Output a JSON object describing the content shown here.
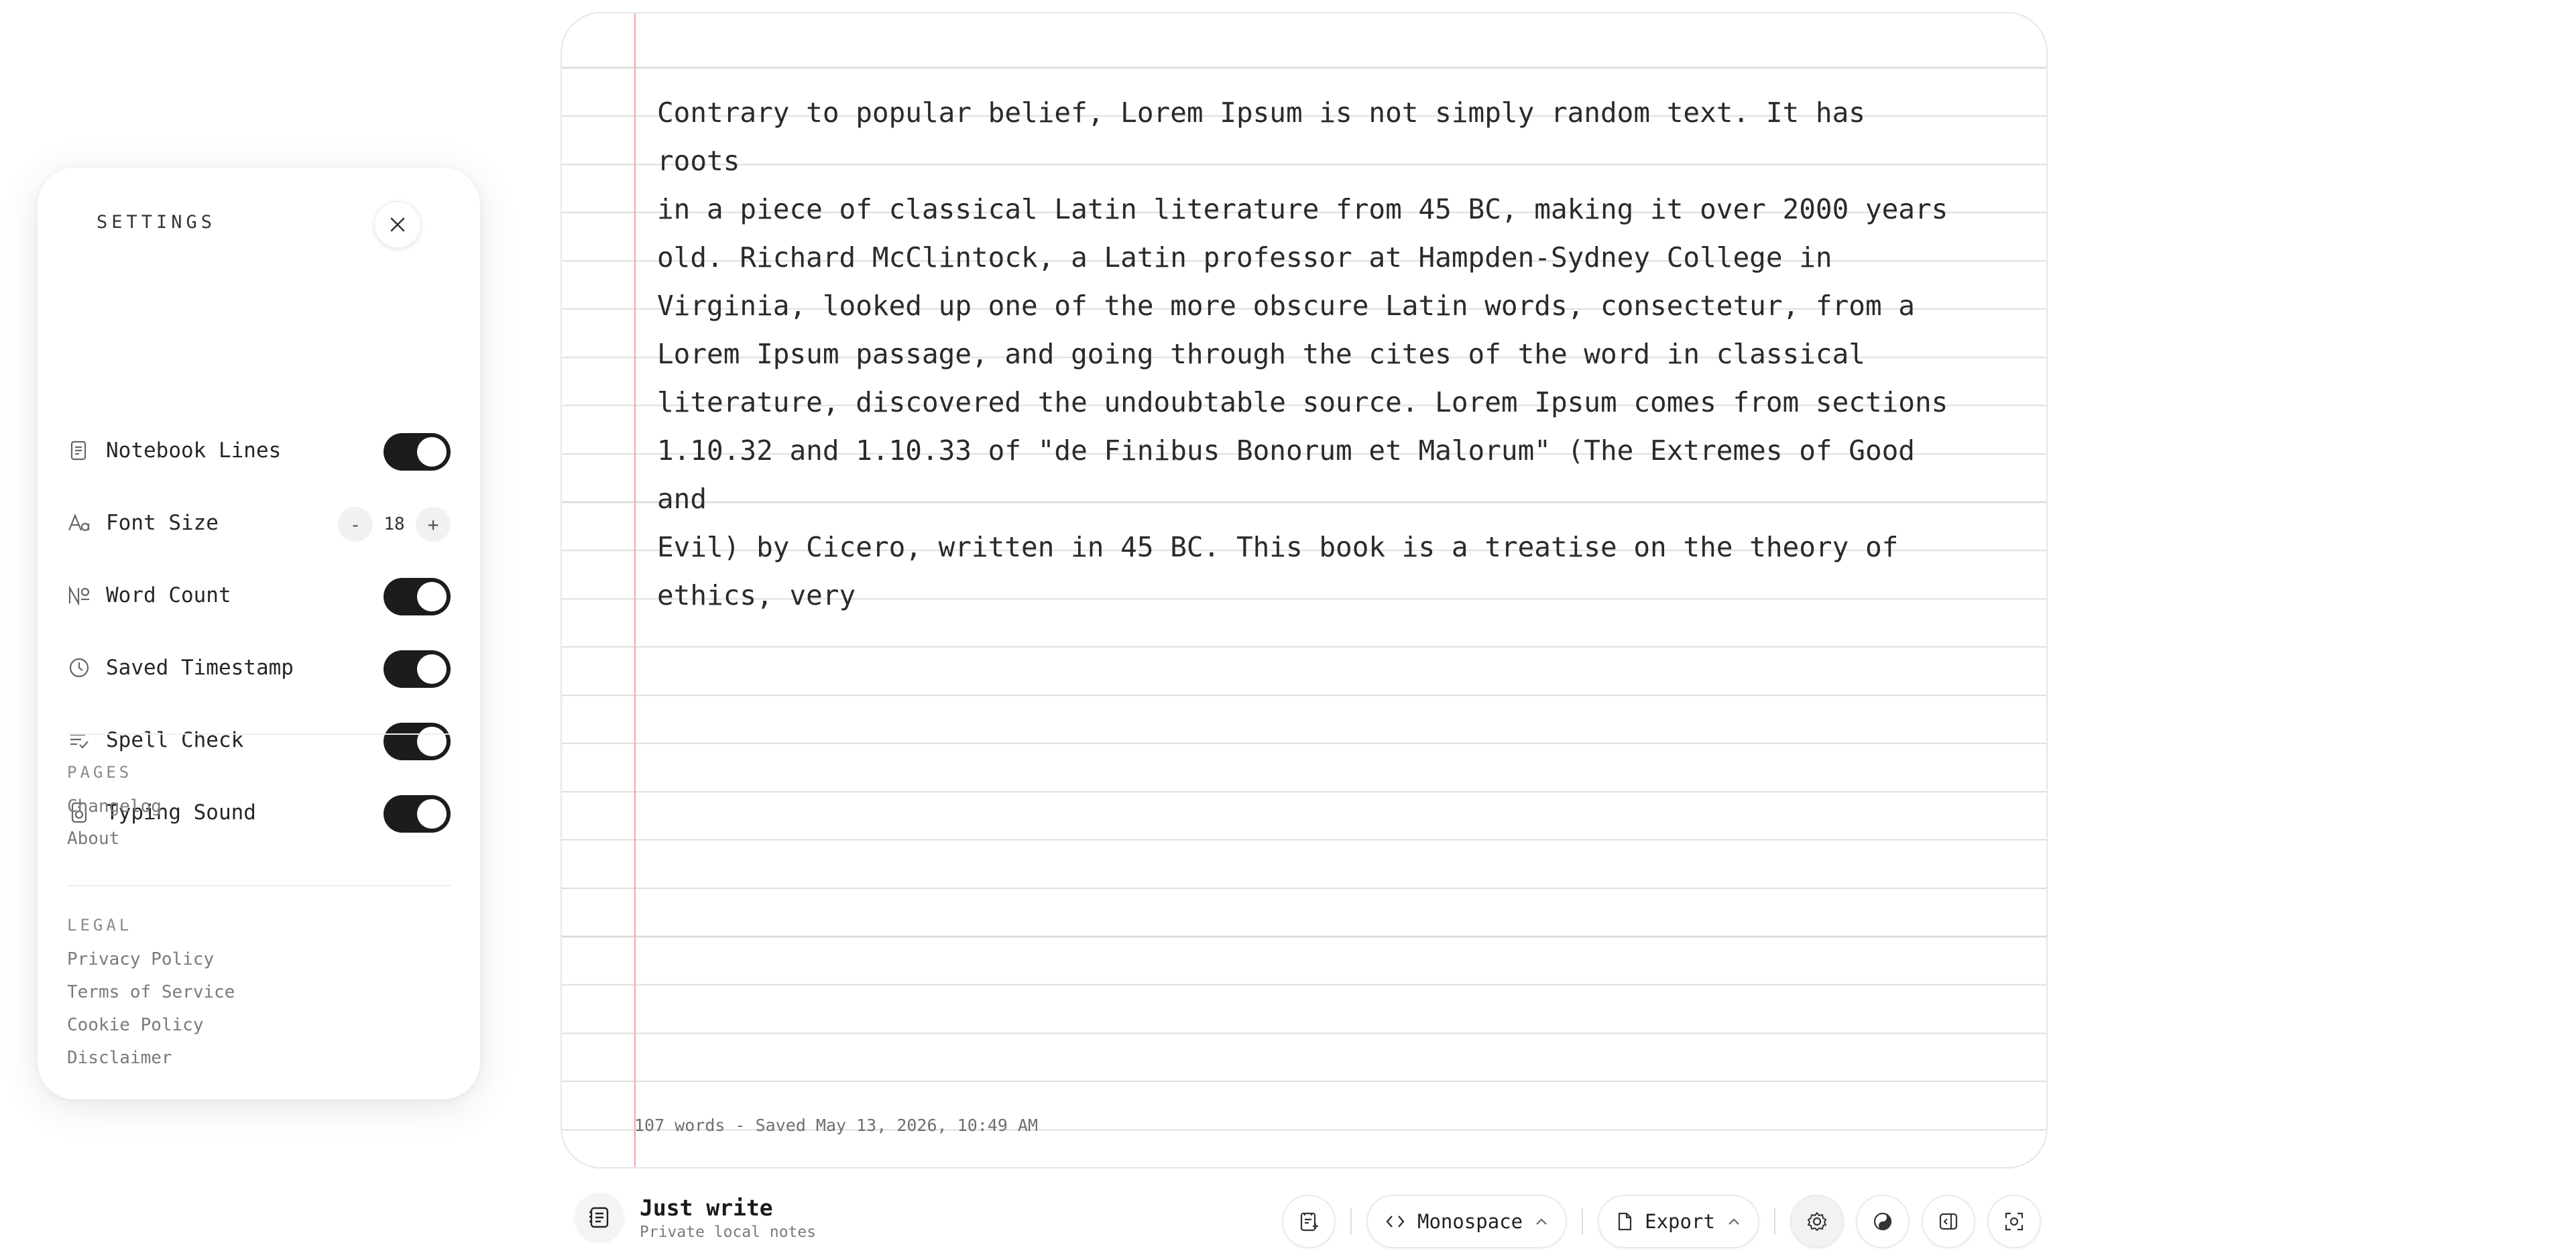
{
  "settings": {
    "title": "SETTINGS",
    "rows": [
      {
        "label": "Notebook Lines",
        "icon": "notebook-icon",
        "type": "toggle",
        "on": true
      },
      {
        "label": "Font Size",
        "icon": "font-size-icon",
        "type": "stepper",
        "value": "18"
      },
      {
        "label": "Word Count",
        "icon": "number-sign-icon",
        "type": "toggle",
        "on": true
      },
      {
        "label": "Saved Timestamp",
        "icon": "clock-icon",
        "type": "toggle",
        "on": true
      },
      {
        "label": "Spell Check",
        "icon": "spell-check-icon",
        "type": "toggle",
        "on": true
      },
      {
        "label": "Typing Sound",
        "icon": "speaker-icon",
        "type": "toggle",
        "on": true
      }
    ],
    "stepper": {
      "minus": "-",
      "plus": "+"
    },
    "pages": {
      "heading": "PAGES",
      "links": [
        "Changelog",
        "About"
      ]
    },
    "legal": {
      "heading": "LEGAL",
      "links": [
        "Privacy Policy",
        "Terms of Service",
        "Cookie Policy",
        "Disclaimer"
      ]
    }
  },
  "editor": {
    "text": "Contrary to popular belief, Lorem Ipsum is not simply random text. It has roots\nin a piece of classical Latin literature from 45 BC, making it over 2000 years\nold. Richard McClintock, a Latin professor at Hampden-Sydney College in\nVirginia, looked up one of the more obscure Latin words, consectetur, from a\nLorem Ipsum passage, and going through the cites of the word in classical\nliterature, discovered the undoubtable source. Lorem Ipsum comes from sections\n1.10.32 and 1.10.33 of \"de Finibus Bonorum et Malorum\" (The Extremes of Good and\nEvil) by Cicero, written in 45 BC. This book is a treatise on the theory of\nethics, very",
    "status": "107 words - Saved May 13, 2026, 10:49 AM"
  },
  "brand": {
    "name": "Just write",
    "subtitle": "Private local notes"
  },
  "toolbar": {
    "font_label": "Monospace",
    "export_label": "Export"
  },
  "colors": {
    "accent": "#1c1c1c",
    "margin": "#f1a6a6",
    "rule": "#dcdcdc"
  }
}
